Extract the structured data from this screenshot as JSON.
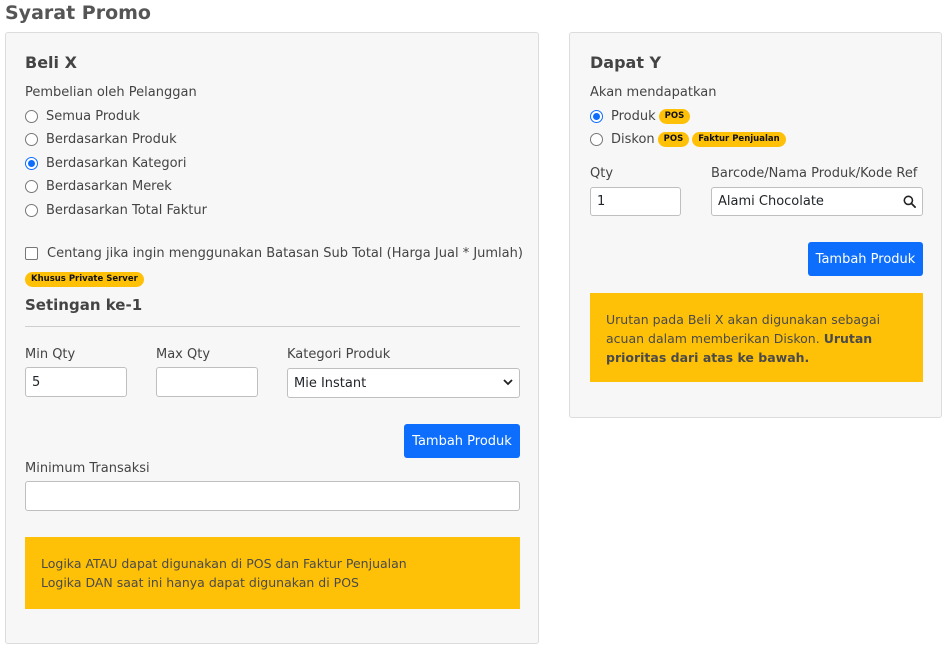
{
  "page": {
    "title": "Syarat Promo"
  },
  "beli_x": {
    "title": "Beli X",
    "purchase_label": "Pembelian oleh Pelanggan",
    "options": [
      {
        "label": "Semua Produk",
        "checked": false
      },
      {
        "label": "Berdasarkan Produk",
        "checked": false
      },
      {
        "label": "Berdasarkan Kategori",
        "checked": true
      },
      {
        "label": "Berdasarkan Merek",
        "checked": false
      },
      {
        "label": "Berdasarkan Total Faktur",
        "checked": false
      }
    ],
    "subtotal_check_label": "Centang jika ingin menggunakan Batasan Sub Total (Harga Jual * Jumlah)",
    "private_badge": "Khusus Private Server",
    "setting_title": "Setingan ke-1",
    "min_qty_label": "Min Qty",
    "min_qty_value": "5",
    "max_qty_label": "Max Qty",
    "max_qty_value": "",
    "category_label": "Kategori Produk",
    "category_value": "Mie Instant",
    "add_button": "Tambah Produk",
    "min_transaction_label": "Minimum Transaksi",
    "min_transaction_value": "",
    "alert_line1": "Logika ATAU dapat digunakan di POS dan Faktur Penjualan",
    "alert_line2": "Logika DAN saat ini hanya dapat digunakan di POS"
  },
  "dapat_y": {
    "title": "Dapat Y",
    "get_label": "Akan mendapatkan",
    "product_option": "Produk",
    "discount_option": "Diskon",
    "badge_pos": "POS",
    "badge_faktur": "Faktur Penjualan",
    "qty_label": "Qty",
    "qty_value": "1",
    "barcode_label": "Barcode/Nama Produk/Kode Ref",
    "barcode_value": "Alami Chocolate",
    "add_button": "Tambah Produk",
    "alert_text": "Urutan pada Beli X akan digunakan sebagai acuan dalam memberikan Diskon.",
    "alert_bold": "Urutan prioritas dari atas ke bawah."
  },
  "colors": {
    "primary": "#0d6efd",
    "warning": "#ffc107"
  },
  "icons": {
    "search": "search-icon",
    "select": "chevron-down-icon"
  }
}
